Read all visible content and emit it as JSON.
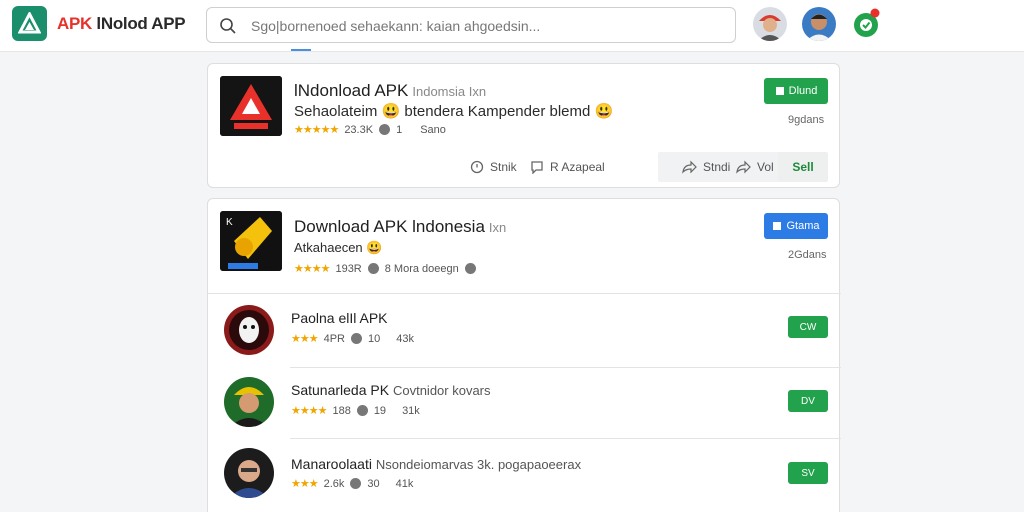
{
  "header": {
    "brand_red": "APK",
    "brand_dark": " lNolod APP",
    "search_text": "Sgo|bornenoed sehaekann: kaian ahgoedsin..."
  },
  "featured": {
    "title": "lNdonload APK",
    "title_tag": "Indomsia Ixn",
    "subtitle": "Sehaolateim 😃 btendera Kampender blemd 😃",
    "stars": "★★★★★",
    "rating": "23.3K",
    "count": "1",
    "extra": "Sano",
    "button": "Dlund",
    "size": "9gdans",
    "actions": {
      "a1": "Stnik",
      "a2": "R Azapeal",
      "a3": "Stndi",
      "a4": "Vol"
    },
    "sell_label": "Sell"
  },
  "download": {
    "title": "Download APK lndonesia",
    "title_tag": "Ixn",
    "subtitle": "Atkahaecen 😃",
    "stars": "★★★★",
    "rating": "193R",
    "extra": "8 Mora doeegn",
    "button": "Gtama",
    "size": "2Gdans"
  },
  "list": [
    {
      "title": "Paolna elIl APK",
      "extra": "",
      "stars": "★★★",
      "rating": "4PR",
      "count": "10",
      "size": "43k",
      "button": "CW"
    },
    {
      "title": "Satunarleda PK",
      "extra": "Covtnidor kovars",
      "stars": "★★★★",
      "rating": "188",
      "count": "19",
      "size": "31k",
      "button": "DV"
    },
    {
      "title": "Manaroolaati",
      "extra": "Nsondeiomarvas 3k. pogapaoeerax",
      "stars": "★★★",
      "rating": "2.6k",
      "count": "30",
      "size": "41k",
      "button": "SV"
    }
  ],
  "colors": {
    "green": "#23a24d",
    "blue": "#2d7be5",
    "brand_red": "#e8312b",
    "logo_green": "#1b8f6b"
  }
}
